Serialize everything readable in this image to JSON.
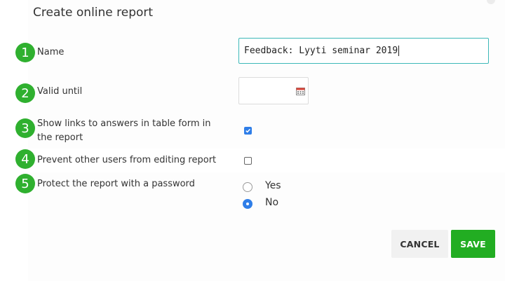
{
  "dialog": {
    "title": "Create online report"
  },
  "fields": [
    {
      "number": "1",
      "label": "Name",
      "value": "Feedback: Lyyti seminar 2019"
    },
    {
      "number": "2",
      "label": "Valid until",
      "value": ""
    },
    {
      "number": "3",
      "label_line1": "Show links to answers in table form in",
      "label_line2": "the report",
      "checked": true
    },
    {
      "number": "4",
      "label": "Prevent other users from editing report",
      "checked": false
    },
    {
      "number": "5",
      "label": "Protect the report with a password",
      "options": [
        {
          "label": "Yes",
          "selected": false
        },
        {
          "label": "No",
          "selected": true
        }
      ]
    }
  ],
  "buttons": {
    "cancel": "CANCEL",
    "save": "SAVE"
  },
  "colors": {
    "badge": "#2fb02f",
    "save": "#22ad22",
    "accent": "#2f7ee8",
    "input_focus": "#3cb8b8"
  },
  "icons": {
    "date_picker": "calendar-icon"
  }
}
